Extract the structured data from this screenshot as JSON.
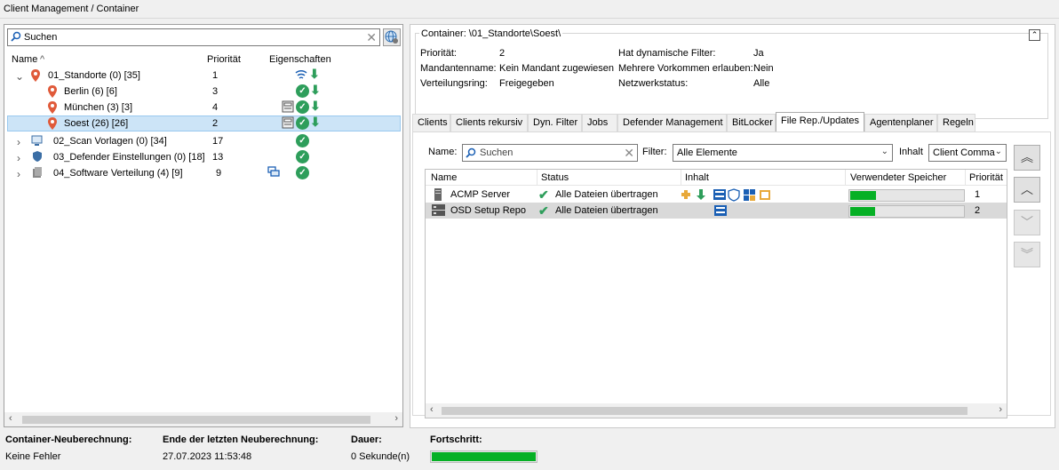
{
  "window": {
    "title": "Client Management / Container"
  },
  "tree": {
    "search_placeholder": "Suchen",
    "columns": {
      "name": "Name",
      "priority": "Priorität",
      "properties": "Eigenschaften"
    },
    "rows": [
      {
        "label": "01_Standorte (0) [35]",
        "priority": "1"
      },
      {
        "label": "Berlin (6) [6]",
        "priority": "3"
      },
      {
        "label": "München (3) [3]",
        "priority": "4"
      },
      {
        "label": "Soest (26) [26]",
        "priority": "2"
      },
      {
        "label": "02_Scan Vorlagen (0) [34]",
        "priority": "17"
      },
      {
        "label": "03_Defender Einstellungen (0) [18]",
        "priority": "13"
      },
      {
        "label": "04_Software Verteilung (4) [9]",
        "priority": "9"
      }
    ],
    "pin_color": "#e05a3a",
    "check_color": "#2e9e5b"
  },
  "container": {
    "legend": "Container: \\01_Standorte\\Soest\\",
    "fields": [
      {
        "label": "Priorität:",
        "value": "2"
      },
      {
        "label": "Mandantenname:",
        "value": "Kein Mandant zugewiesen"
      },
      {
        "label": "Verteilungsring:",
        "value": "Freigegeben"
      },
      {
        "label": "Hat dynamische Filter:",
        "value": "Ja"
      },
      {
        "label": "Mehrere Vorkommen erlauben:",
        "value": "Nein"
      },
      {
        "label": "Netzwerkstatus:",
        "value": "Alle"
      }
    ]
  },
  "tabs": [
    "Clients",
    "Clients rekursiv",
    "Dyn. Filter",
    "Jobs",
    "Defender Management",
    "BitLocker",
    "File Rep./Updates",
    "Agentenplaner",
    "Regeln"
  ],
  "active_tab": "File Rep./Updates",
  "filerep": {
    "name_label": "Name:",
    "search_placeholder": "Suchen",
    "filter_label": "Filter:",
    "filter_value": "Alle Elemente",
    "inhalt_label": "Inhalt",
    "inhalt_value": "Client Comma",
    "columns": {
      "name": "Name",
      "status": "Status",
      "inhalt": "Inhalt",
      "speicher": "Verwendeter Speicher",
      "prio": "Priorität"
    },
    "rows": [
      {
        "name": "ACMP Server",
        "status": "Alle Dateien übertragen",
        "storage_fraction": 0.23,
        "prio": "1"
      },
      {
        "name": "OSD Setup Repo",
        "status": "Alle Dateien übertragen",
        "storage_fraction": 0.22,
        "prio": "2"
      }
    ],
    "bar_color": "#06b025"
  },
  "footer": {
    "h1": "Container-Neuberechnung:",
    "h2": "Ende der letzten Neuberechnung:",
    "h3": "Dauer:",
    "h4": "Fortschritt:",
    "v1": "Keine Fehler",
    "v2": "27.07.2023 11:53:48",
    "v3": "0 Sekunde(n)",
    "progress_fraction": 1.0
  }
}
